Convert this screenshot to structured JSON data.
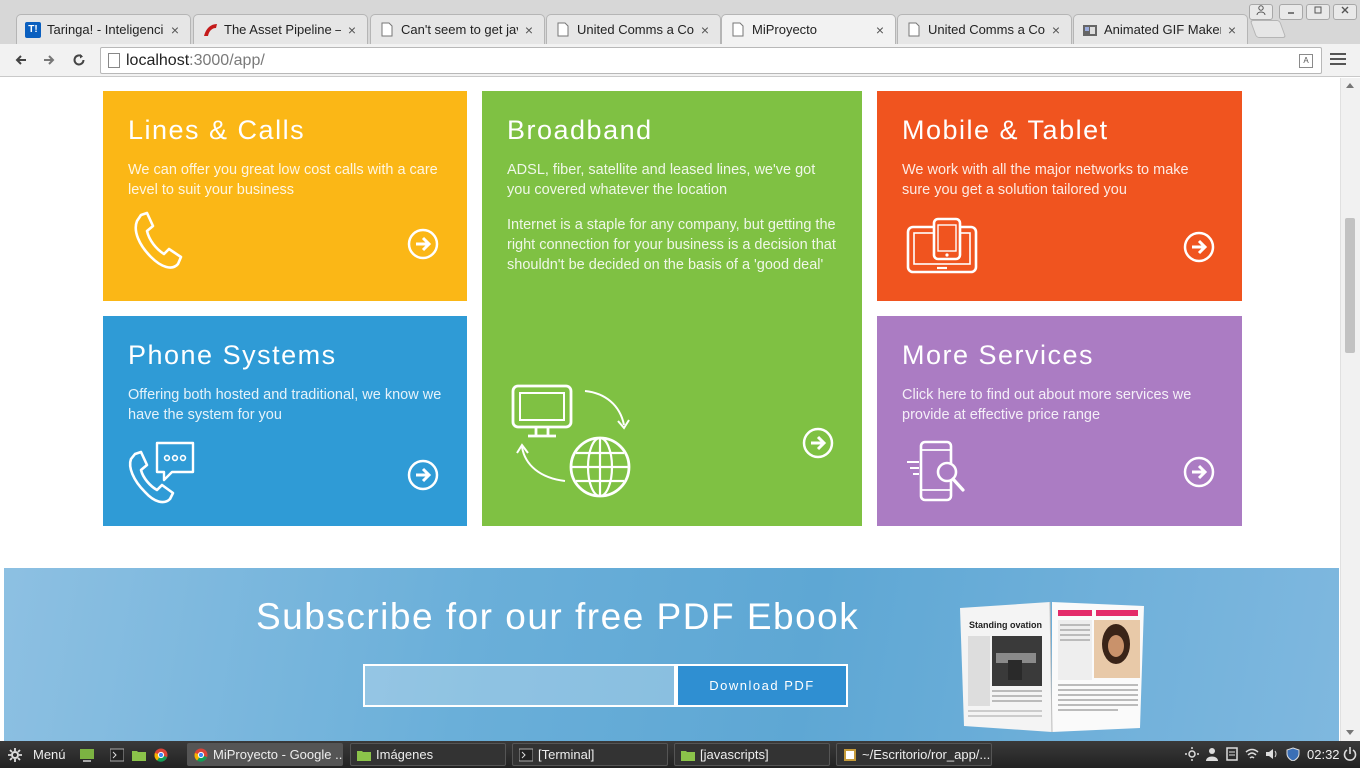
{
  "browser": {
    "tabs": [
      {
        "label": "Taringa! - Inteligencia",
        "icon": "taringa-icon",
        "icon_text": "T!",
        "color": "#0a5fbf"
      },
      {
        "label": "The Asset Pipeline —",
        "icon": "rails-icon",
        "icon_text": "",
        "color": "#c41a1a"
      },
      {
        "label": "Can't seem to get java",
        "icon": "page-icon",
        "icon_text": "",
        "color": ""
      },
      {
        "label": "United Comms a Corpo",
        "icon": "page-icon",
        "icon_text": "",
        "color": ""
      },
      {
        "label": "MiProyecto",
        "icon": "page-icon",
        "icon_text": "",
        "color": "",
        "active": true
      },
      {
        "label": "United Comms a Corpo",
        "icon": "page-icon",
        "icon_text": "",
        "color": ""
      },
      {
        "label": "Animated GIF Maker",
        "icon": "gif-maker-icon",
        "icon_text": "",
        "color": "#555"
      }
    ],
    "close_glyph": "×",
    "url_host": "localhost",
    "url_rest": ":3000/app/"
  },
  "cards": {
    "lines": {
      "title": "Lines & Calls",
      "text": "We can offer you great low cost calls with a care level to suit your business",
      "color": "#fbb716"
    },
    "broadband": {
      "title": "Broadband",
      "text": "ADSL, fiber, satellite and leased lines, we've got you covered whatever the location",
      "text2": "Internet is a staple for any company, but getting the right connection for your business is a decision that shouldn't be decided on the basis of a 'good deal'",
      "color": "#7fc143"
    },
    "mobile": {
      "title": "Mobile & Tablet",
      "text": "We work with all the major networks to make sure you get a solution tailored you",
      "color": "#f0541f"
    },
    "phone": {
      "title": "Phone Systems",
      "text": "Offering both hosted and traditional, we know we have the system for you",
      "color": "#2f9bd6"
    },
    "more": {
      "title": "More Services",
      "text": "Click here to find out about more services we provide at effective price range",
      "color": "#ab7cc3"
    }
  },
  "subscribe": {
    "title": "Subscribe for our free PDF Ebook",
    "input_value": "",
    "button_label": "Download PDF",
    "magazine_headline": "Standing ovation"
  },
  "taskbar": {
    "menu_label": "Menú",
    "tasks": [
      {
        "label": "MiProyecto - Google ...",
        "active": true
      },
      {
        "label": "Imágenes"
      },
      {
        "label": "[Terminal]"
      },
      {
        "label": "[javascripts]"
      },
      {
        "label": "~/Escritorio/ror_app/..."
      }
    ],
    "clock": "02:32"
  }
}
